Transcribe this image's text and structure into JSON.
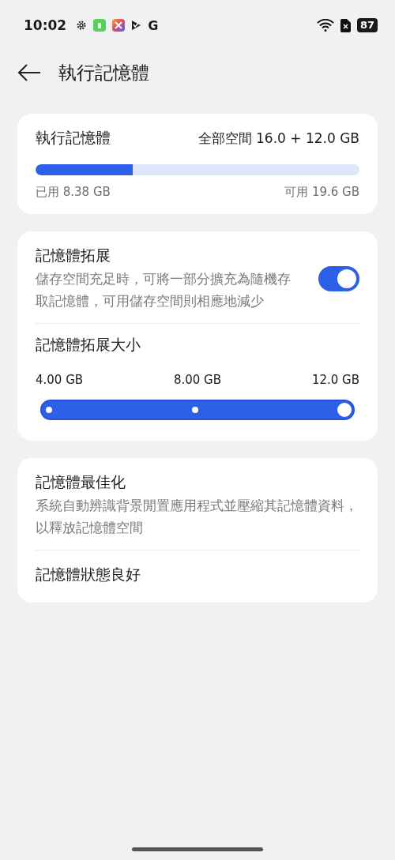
{
  "status_bar": {
    "time": "10:02",
    "google_glyph": "G",
    "battery": "87"
  },
  "header": {
    "title": "執行記憶體"
  },
  "ram_card": {
    "title": "執行記憶體",
    "total": "全部空間 16.0 + 12.0 GB",
    "level": 0.3,
    "used": "已用 8.38 GB",
    "available": "可用 19.6 GB"
  },
  "expansion_card": {
    "title": "記憶體拓展",
    "description": "儲存空間充足時，可將一部分擴充為隨機存取記憶體，可用儲存空間則相應地減少",
    "on": true,
    "size_title": "記憶體拓展大小",
    "size_options": [
      {
        "label": "4.00 GB",
        "selected": false
      },
      {
        "label": "8.00 GB",
        "selected": false
      },
      {
        "label": "12.0 GB",
        "selected": true
      }
    ],
    "level": 1
  },
  "optimize_card": {
    "title": "記憶體最佳化",
    "description": "系統自動辨識背景閒置應用程式並壓縮其記憶體資料，以釋放記憶體空間",
    "status": "記憶體狀態良好"
  }
}
